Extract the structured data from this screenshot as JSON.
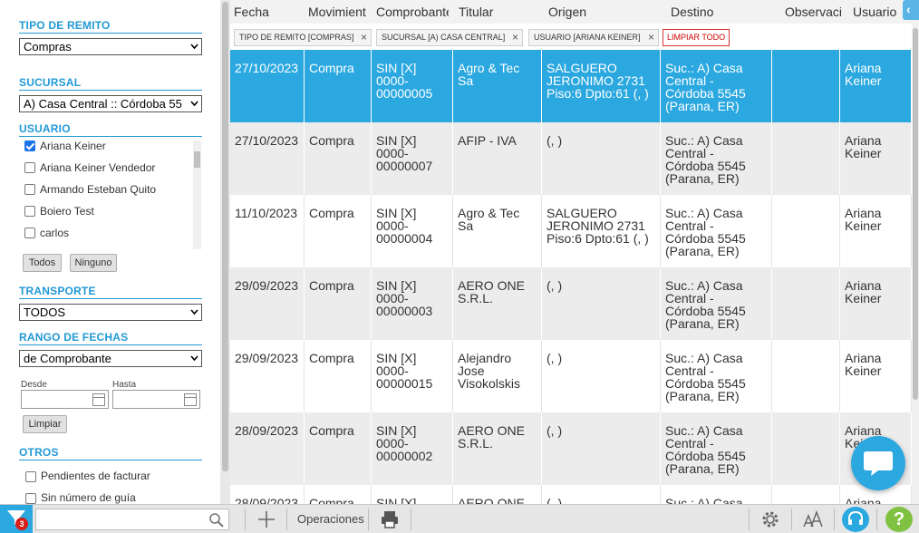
{
  "sidebar": {
    "tipo_remito": {
      "title": "TIPO DE REMITO",
      "value": "Compras"
    },
    "sucursal": {
      "title": "SUCURSAL",
      "value": "A) Casa Central :: Córdoba 55"
    },
    "usuario": {
      "title": "USUARIO",
      "items": [
        {
          "label": "Ariana Keiner",
          "checked": true
        },
        {
          "label": "Ariana Keiner Vendedor",
          "checked": false
        },
        {
          "label": "Armando Esteban Quito",
          "checked": false
        },
        {
          "label": "Boiero Test",
          "checked": false
        },
        {
          "label": "carlos",
          "checked": false
        }
      ],
      "todos_label": "Todos",
      "ninguno_label": "Ninguno"
    },
    "transporte": {
      "title": "TRANSPORTE",
      "value": "TODOS"
    },
    "rango_fechas": {
      "title": "RANGO DE FECHAS",
      "value": "de Comprobante",
      "desde_label": "Desde",
      "hasta_label": "Hasta",
      "limpiar_label": "Limpiar"
    },
    "otros": {
      "title": "OTROS",
      "items": [
        {
          "label": "Pendientes de facturar",
          "checked": false
        },
        {
          "label": "Sin número de guía",
          "checked": false
        }
      ]
    }
  },
  "table": {
    "columns": [
      "Fecha",
      "Movimient",
      "Comprobante",
      "Titular",
      "Origen",
      "Destino",
      "Observaci",
      "Usuario"
    ],
    "filters": [
      {
        "label": "TIPO DE REMITO [COMPRAS]",
        "x_label": "×"
      },
      {
        "label": "SUCURSAL [A) CASA CENTRAL]",
        "x_label": "×"
      },
      {
        "label": "USUARIO [ARIANA KEINER]",
        "x_label": "×"
      }
    ],
    "clear_all_label": "LIMPIAR TODO",
    "rows": [
      {
        "fecha": "27/10/2023",
        "mov": "Compra",
        "comp": "SIN [X] 0000-00000005",
        "titular": "Agro & Tec Sa",
        "origen": "SALGUERO JERONIMO 2731 Piso:6 Dpto:61 (, )",
        "destino": "Suc.: A) Casa Central - Córdoba 5545 (Parana, ER)",
        "obs": "",
        "usuario": "Ariana Keiner"
      },
      {
        "fecha": "27/10/2023",
        "mov": "Compra",
        "comp": "SIN [X] 0000-00000007",
        "titular": "AFIP - IVA",
        "origen": "(, )",
        "destino": "Suc.: A) Casa Central - Córdoba 5545 (Parana, ER)",
        "obs": "",
        "usuario": "Ariana Keiner"
      },
      {
        "fecha": "11/10/2023",
        "mov": "Compra",
        "comp": "SIN [X] 0000-00000004",
        "titular": "Agro & Tec Sa",
        "origen": "SALGUERO JERONIMO 2731 Piso:6 Dpto:61 (, )",
        "destino": "Suc.: A) Casa Central - Córdoba 5545 (Parana, ER)",
        "obs": "",
        "usuario": "Ariana Keiner"
      },
      {
        "fecha": "29/09/2023",
        "mov": "Compra",
        "comp": "SIN [X] 0000-00000003",
        "titular": "AERO ONE S.R.L.",
        "origen": "(, )",
        "destino": "Suc.: A) Casa Central - Córdoba 5545 (Parana, ER)",
        "obs": "",
        "usuario": "Ariana Keiner"
      },
      {
        "fecha": "29/09/2023",
        "mov": "Compra",
        "comp": "SIN [X] 0000-00000015",
        "titular": "Alejandro Jose Visokolskis",
        "origen": "(, )",
        "destino": "Suc.: A) Casa Central - Córdoba 5545 (Parana, ER)",
        "obs": "",
        "usuario": "Ariana Keiner"
      },
      {
        "fecha": "28/09/2023",
        "mov": "Compra",
        "comp": "SIN [X] 0000-00000002",
        "titular": "AERO ONE S.R.L.",
        "origen": "(, )",
        "destino": "Suc.: A) Casa Central - Córdoba 5545 (Parana, ER)",
        "obs": "",
        "usuario": "Ariana Keiner"
      },
      {
        "fecha": "28/09/2023",
        "mov": "Compra",
        "comp": "SIN [X]",
        "titular": "AERO ONE",
        "origen": "(, )",
        "destino": "Suc.: A) Casa",
        "obs": "",
        "usuario": "Ariana"
      }
    ]
  },
  "toolbar": {
    "badge_count": "3",
    "search_placeholder": "",
    "operaciones_label": "Operaciones",
    "help_label": "?"
  },
  "colors": {
    "accent": "#2ba8e0",
    "section_title": "#2299d6",
    "help_green": "#7fc241",
    "badge_red": "#d91e18"
  }
}
